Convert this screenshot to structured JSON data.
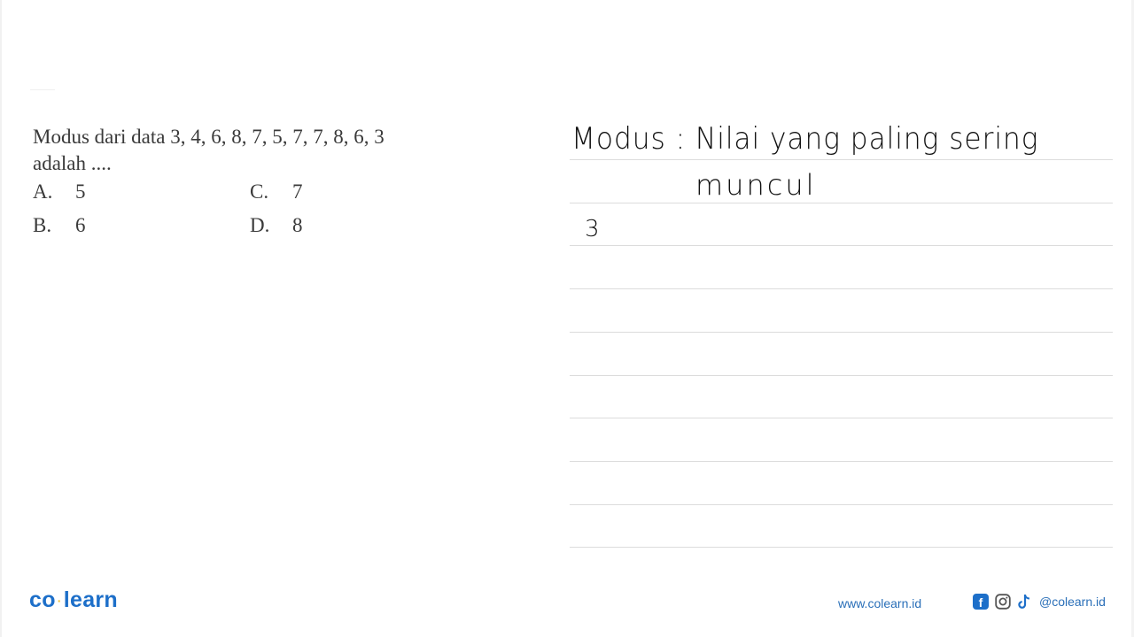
{
  "question": {
    "stem_line1": "Modus dari data 3, 4, 6, 8, 7, 5, 7, 7, 8, 6, 3",
    "stem_line2": "adalah ....",
    "options": [
      {
        "letter": "A.",
        "value": "5"
      },
      {
        "letter": "B.",
        "value": "6"
      },
      {
        "letter": "C.",
        "value": "7"
      },
      {
        "letter": "D.",
        "value": "8"
      }
    ]
  },
  "handwritten": {
    "line1": "Modus : Nilai yang paling sering",
    "line2": "muncul",
    "line3": "3"
  },
  "notebook": {
    "ruled_line_count": 10
  },
  "footer": {
    "logo_part1": "co",
    "logo_separator": "·",
    "logo_part2": "learn",
    "website": "www.colearn.id",
    "social_icons": [
      "facebook-icon",
      "instagram-icon",
      "tiktok-icon"
    ],
    "facebook_glyph": "f",
    "handle": "@colearn.id",
    "brand_color": "#1d6fc9",
    "accent_color": "#f2c12e"
  }
}
